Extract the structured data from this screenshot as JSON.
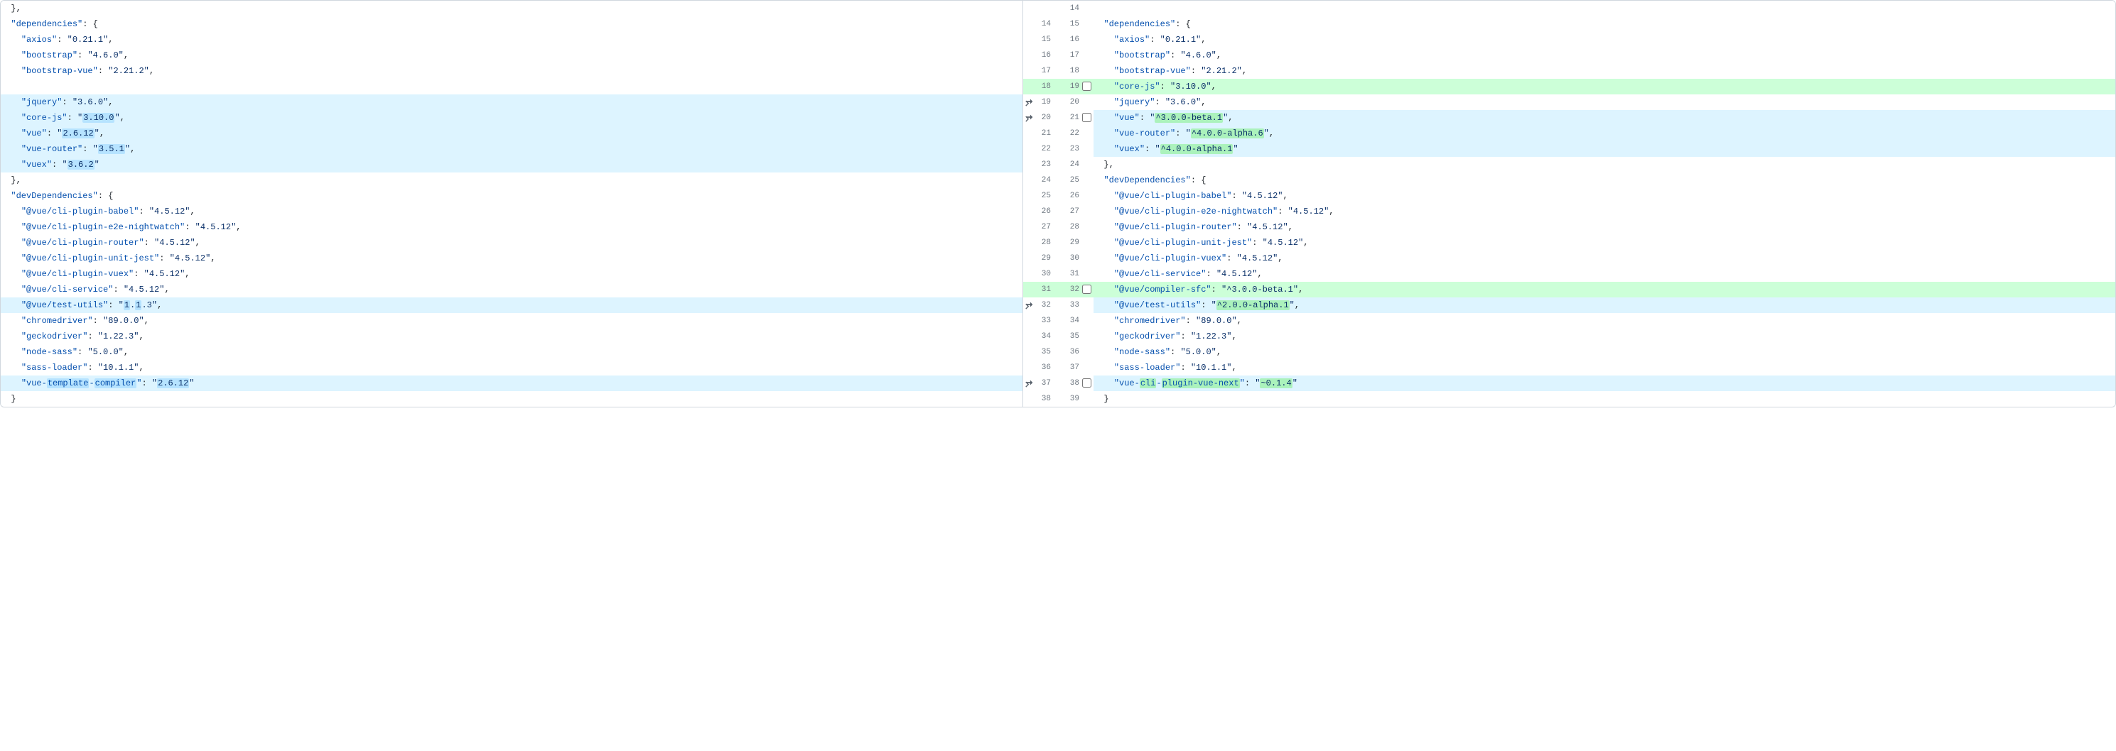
{
  "diff": {
    "rows": [
      {
        "left_num": "",
        "right_num": "14",
        "left": {
          "indent": 1,
          "kind": "close-brace-comma"
        },
        "right": null,
        "type": "ctx",
        "row_name": "row-close-private"
      },
      {
        "left_num": "14",
        "right_num": "15",
        "left": {
          "indent": 1,
          "key": "dependencies",
          "open": true
        },
        "right": {
          "indent": 1,
          "key": "dependencies",
          "open": true
        },
        "type": "ctx",
        "row_name": "row-dependencies-open"
      },
      {
        "left_num": "15",
        "right_num": "16",
        "left": {
          "indent": 2,
          "key": "axios",
          "val": "0.21.1",
          "comma": true
        },
        "right": {
          "indent": 2,
          "key": "axios",
          "val": "0.21.1",
          "comma": true
        },
        "type": "ctx",
        "row_name": "row-axios"
      },
      {
        "left_num": "16",
        "right_num": "17",
        "left": {
          "indent": 2,
          "key": "bootstrap",
          "val": "4.6.0",
          "comma": true
        },
        "right": {
          "indent": 2,
          "key": "bootstrap",
          "val": "4.6.0",
          "comma": true
        },
        "type": "ctx",
        "row_name": "row-bootstrap"
      },
      {
        "left_num": "17",
        "right_num": "18",
        "left": {
          "indent": 2,
          "key": "bootstrap-vue",
          "val": "2.21.2",
          "comma": true
        },
        "right": {
          "indent": 2,
          "key": "bootstrap-vue",
          "val": "2.21.2",
          "comma": true
        },
        "type": "ctx",
        "row_name": "row-bootstrap-vue"
      },
      {
        "left_num": "18",
        "right_num": "19",
        "left": null,
        "right": {
          "indent": 2,
          "key": "core-js",
          "val": "3.10.0",
          "comma": true
        },
        "type": "add",
        "checkbox": true,
        "row_name": "row-core-js-add"
      },
      {
        "left_num": "19",
        "right_num": "20",
        "left": {
          "indent": 2,
          "key": "jquery",
          "val": "3.6.0",
          "comma": true
        },
        "right": {
          "indent": 2,
          "key": "jquery",
          "val": "3.6.0",
          "comma": true
        },
        "type": "mod-l",
        "moved": true,
        "row_name": "row-jquery"
      },
      {
        "left_num": "20",
        "right_num": "21",
        "left": {
          "indent": 2,
          "key": "core-js",
          "val": "3.10.0",
          "comma": true,
          "val_wdel": true
        },
        "right": {
          "indent": 2,
          "key": "vue",
          "val": "^3.0.0-beta.1",
          "comma": true,
          "val_wadd": true
        },
        "type": "mod-lr",
        "moved": true,
        "checkbox": true,
        "row_name": "row-core-js-vue"
      },
      {
        "left_num": "21",
        "right_num": "22",
        "left": {
          "indent": 2,
          "key": "vue",
          "val": "2.6.12",
          "comma": true,
          "val_wdel": true
        },
        "right": {
          "indent": 2,
          "key": "vue-router",
          "val": "^4.0.0-alpha.6",
          "comma": true,
          "val_wadd": true
        },
        "type": "mod-lr",
        "row_name": "row-vue-router"
      },
      {
        "left_num": "22",
        "right_num": "23",
        "left": {
          "indent": 2,
          "key": "vue-router",
          "val": "3.5.1",
          "comma": true,
          "val_wdel": true
        },
        "right": {
          "indent": 2,
          "key": "vuex",
          "val": "^4.0.0-alpha.1",
          "comma": false,
          "val_wadd": true
        },
        "type": "mod-lr",
        "row_name": "row-vuex"
      },
      {
        "left_num": "23",
        "right_num": "24",
        "left": {
          "indent": 2,
          "key": "vuex",
          "val": "3.6.2",
          "comma": false,
          "val_wdel": true
        },
        "right": {
          "indent": 1,
          "kind": "close-brace-comma"
        },
        "type": "mod-l",
        "row_name": "row-vuex-close"
      },
      {
        "left_num": "24",
        "right_num": "25",
        "left": {
          "indent": 1,
          "kind": "close-brace-comma"
        },
        "right": {
          "indent": 1,
          "key": "devDependencies",
          "open": true
        },
        "type": "ctx",
        "row_name": "row-deps-close"
      },
      {
        "left_num": "25",
        "right_num": "26",
        "left": {
          "indent": 1,
          "key": "devDependencies",
          "open": true
        },
        "right": {
          "indent": 2,
          "key": "@vue/cli-plugin-babel",
          "val": "4.5.12",
          "comma": true
        },
        "type": "ctx",
        "row_name": "row-devdeps-open"
      },
      {
        "left_num": "26",
        "right_num": "27",
        "left": {
          "indent": 2,
          "key": "@vue/cli-plugin-babel",
          "val": "4.5.12",
          "comma": true
        },
        "right": {
          "indent": 2,
          "key": "@vue/cli-plugin-e2e-nightwatch",
          "val": "4.5.12",
          "comma": true
        },
        "type": "ctx",
        "row_name": "row-babel"
      },
      {
        "left_num": "27",
        "right_num": "28",
        "left": {
          "indent": 2,
          "key": "@vue/cli-plugin-e2e-nightwatch",
          "val": "4.5.12",
          "comma": true
        },
        "right": {
          "indent": 2,
          "key": "@vue/cli-plugin-router",
          "val": "4.5.12",
          "comma": true
        },
        "type": "ctx",
        "row_name": "row-e2e"
      },
      {
        "left_num": "28",
        "right_num": "29",
        "left": {
          "indent": 2,
          "key": "@vue/cli-plugin-router",
          "val": "4.5.12",
          "comma": true
        },
        "right": {
          "indent": 2,
          "key": "@vue/cli-plugin-unit-jest",
          "val": "4.5.12",
          "comma": true
        },
        "type": "ctx",
        "row_name": "row-cli-router"
      },
      {
        "left_num": "29",
        "right_num": "30",
        "left": {
          "indent": 2,
          "key": "@vue/cli-plugin-unit-jest",
          "val": "4.5.12",
          "comma": true
        },
        "right": {
          "indent": 2,
          "key": "@vue/cli-plugin-vuex",
          "val": "4.5.12",
          "comma": true
        },
        "type": "ctx",
        "row_name": "row-cli-jest"
      },
      {
        "left_num": "30",
        "right_num": "31",
        "left": {
          "indent": 2,
          "key": "@vue/cli-plugin-vuex",
          "val": "4.5.12",
          "comma": true
        },
        "right": {
          "indent": 2,
          "key": "@vue/cli-service",
          "val": "4.5.12",
          "comma": true
        },
        "type": "ctx",
        "row_name": "row-cli-vuex"
      },
      {
        "left_num": "31",
        "right_num": "32",
        "left": {
          "indent": 2,
          "key": "@vue/cli-service",
          "val": "4.5.12",
          "comma": true
        },
        "right": {
          "indent": 2,
          "key": "@vue/compiler-sfc",
          "val": "^3.0.0-beta.1",
          "comma": true
        },
        "type": "add",
        "checkbox": true,
        "row_name": "row-compiler-sfc"
      },
      {
        "left_num": "32",
        "right_num": "33",
        "left": {
          "indent": 2,
          "key": "@vue/test-utils",
          "val": "1.1.3",
          "comma": true,
          "val_worddiff_left": [
            [
              "1",
              "wdel"
            ],
            [
              ".",
              ""
            ],
            [
              "1",
              "wdel"
            ],
            [
              ".",
              ""
            ],
            [
              "3",
              ""
            ]
          ]
        },
        "right": {
          "indent": 2,
          "key": "@vue/test-utils",
          "val": "^2.0.0-alpha.1",
          "comma": true,
          "val_wadd": true
        },
        "type": "mod-lr",
        "moved": true,
        "row_name": "row-test-utils"
      },
      {
        "left_num": "33",
        "right_num": "34",
        "left": {
          "indent": 2,
          "key": "chromedriver",
          "val": "89.0.0",
          "comma": true
        },
        "right": {
          "indent": 2,
          "key": "chromedriver",
          "val": "89.0.0",
          "comma": true
        },
        "type": "ctx",
        "row_name": "row-chromedriver"
      },
      {
        "left_num": "34",
        "right_num": "35",
        "left": {
          "indent": 2,
          "key": "geckodriver",
          "val": "1.22.3",
          "comma": true
        },
        "right": {
          "indent": 2,
          "key": "geckodriver",
          "val": "1.22.3",
          "comma": true
        },
        "type": "ctx",
        "row_name": "row-geckodriver"
      },
      {
        "left_num": "35",
        "right_num": "36",
        "left": {
          "indent": 2,
          "key": "node-sass",
          "val": "5.0.0",
          "comma": true
        },
        "right": {
          "indent": 2,
          "key": "node-sass",
          "val": "5.0.0",
          "comma": true
        },
        "type": "ctx",
        "row_name": "row-node-sass"
      },
      {
        "left_num": "36",
        "right_num": "37",
        "left": {
          "indent": 2,
          "key": "sass-loader",
          "val": "10.1.1",
          "comma": true
        },
        "right": {
          "indent": 2,
          "key": "sass-loader",
          "val": "10.1.1",
          "comma": true
        },
        "type": "ctx",
        "row_name": "row-sass-loader"
      },
      {
        "left_num": "37",
        "right_num": "38",
        "left": {
          "indent": 2,
          "key_worddiff": [
            [
              "vue-",
              ""
            ],
            [
              "template",
              "wdel"
            ],
            [
              "-",
              ""
            ],
            [
              "compiler",
              "wdel"
            ]
          ],
          "val": "2.6.12",
          "val_wdel": true,
          "comma": false
        },
        "right": {
          "indent": 2,
          "key_worddiff": [
            [
              "vue-",
              ""
            ],
            [
              "cli",
              "wadd"
            ],
            [
              "-",
              ""
            ],
            [
              "plugin-vue-next",
              "wadd"
            ]
          ],
          "val": "~0.1.4",
          "val_wadd": true,
          "comma": false
        },
        "type": "mod-lr",
        "moved": true,
        "checkbox": true,
        "row_name": "row-template-compiler"
      },
      {
        "left_num": "38",
        "right_num": "39",
        "left": {
          "indent": 1,
          "kind": "close-brace"
        },
        "right": {
          "indent": 1,
          "kind": "close-brace"
        },
        "type": "ctx",
        "row_name": "row-devdeps-close"
      }
    ]
  }
}
